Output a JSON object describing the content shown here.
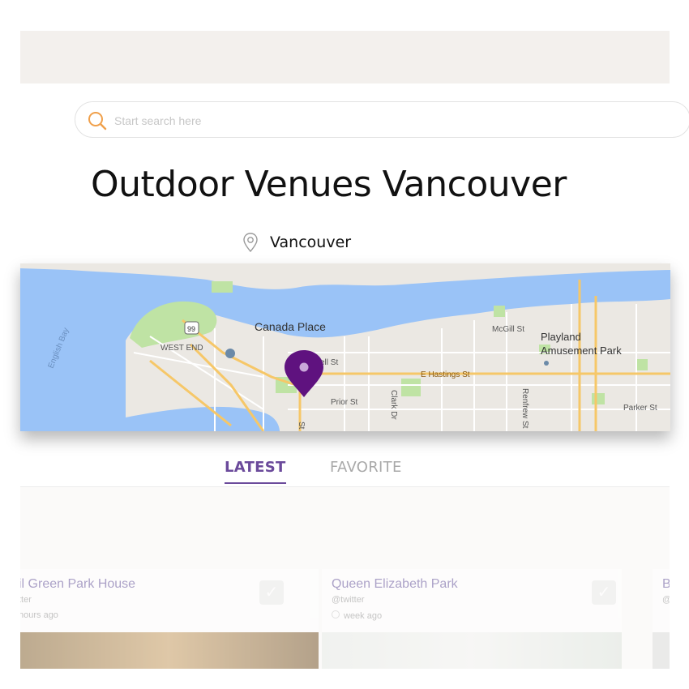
{
  "search": {
    "placeholder": "Start search here",
    "icon": "search-icon"
  },
  "page": {
    "title": "Outdoor Venues Vancouver",
    "location": "Vancouver"
  },
  "map": {
    "labels": {
      "canada_place": "Canada Place",
      "west_end": "WEST END",
      "english_bay": "English Bay",
      "mcgill": "McGill St",
      "playland_line1": "Playland",
      "playland_line2": "Amusement Park",
      "hastings": "E Hastings St",
      "prior": "Prior St",
      "clark": "Clark Dr",
      "renfrew": "Renfrew St",
      "parker": "Parker St",
      "highway": "99",
      "cordova": "ell St",
      "main": "St"
    },
    "colors": {
      "water": "#9ac3f7",
      "land": "#ebe8e3",
      "park": "#bfe3a4",
      "road": "#f6c768",
      "marker": "#5f127f"
    }
  },
  "tabs": [
    {
      "label": "LATEST",
      "active": true
    },
    {
      "label": "FAVORITE",
      "active": false
    }
  ],
  "cards": [
    {
      "name": "il Green Park House",
      "handle": "tter",
      "time": "hours ago"
    },
    {
      "name": "Queen Elizabeth Park",
      "handle": "@twitter",
      "time": "week ago"
    },
    {
      "name": "B",
      "handle": "@"
    }
  ]
}
